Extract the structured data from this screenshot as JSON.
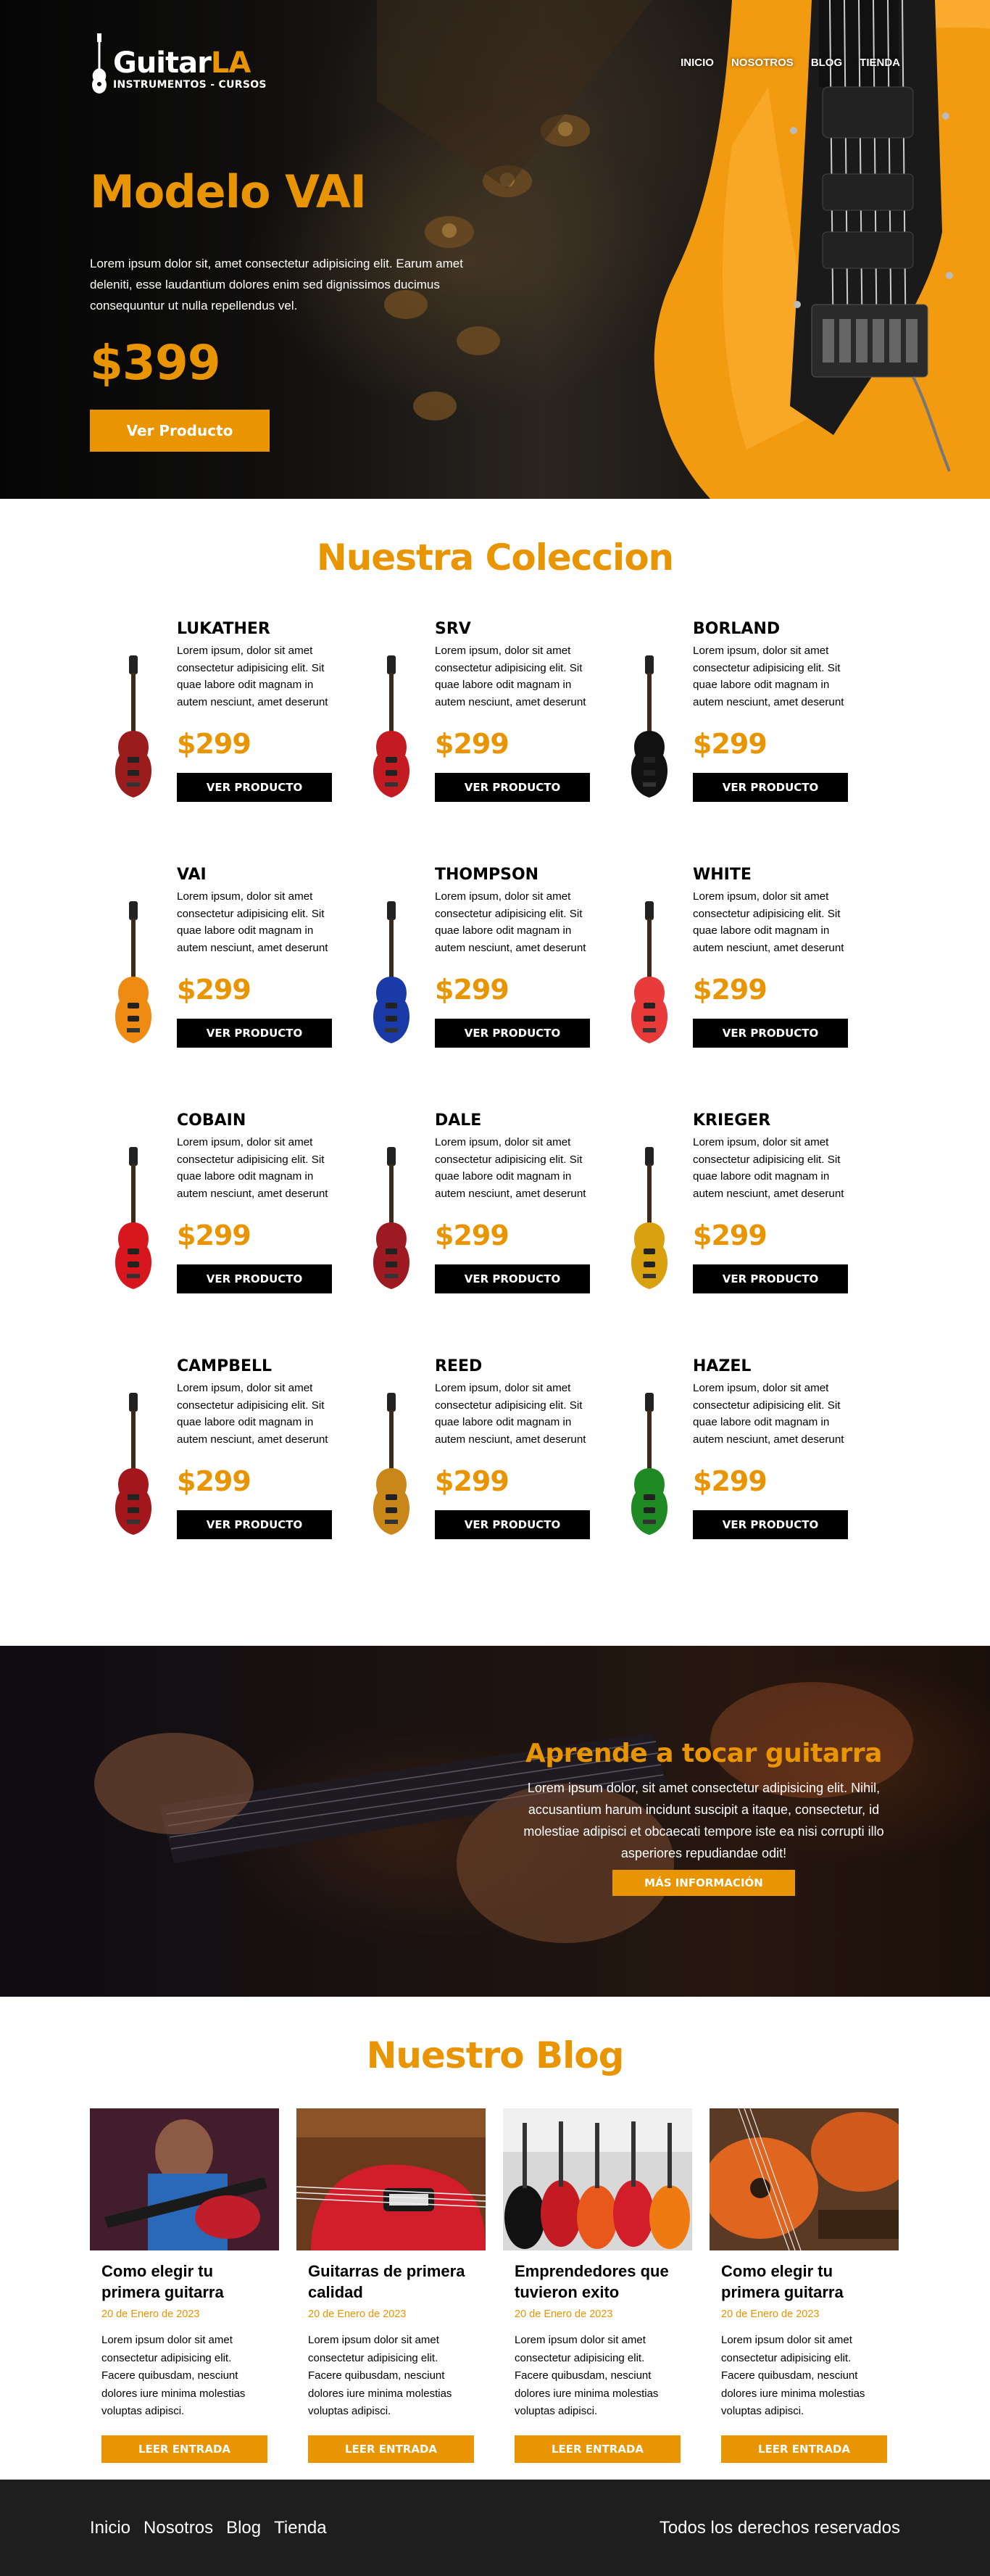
{
  "brand": {
    "name_main": "Guitar",
    "name_accent": "LA",
    "tagline": "INSTRUMENTOS - CURSOS"
  },
  "nav": [
    "Inicio",
    "Nosotros",
    "Blog",
    "Tienda"
  ],
  "hero": {
    "title": "Modelo VAI",
    "description": "Lorem ipsum dolor sit, amet consectetur adipisicing elit. Earum amet deleniti, esse laudantium dolores enim sed dignissimos ducimus consequuntur ut nulla repellendus vel.",
    "price": "$399",
    "button": "Ver Producto"
  },
  "collection": {
    "title": "Nuestra Coleccion",
    "products": [
      {
        "name": "LUKATHER",
        "price": "$299",
        "body": "#9b1c1c",
        "button": "VER PRODUCTO",
        "description": "Lorem ipsum, dolor sit amet consectetur adipisicing elit. Sit quae labore odit magnam in autem nesciunt, amet deserunt"
      },
      {
        "name": "SRV",
        "price": "$299",
        "body": "#c41a22",
        "button": "VER PRODUCTO",
        "description": "Lorem ipsum, dolor sit amet consectetur adipisicing elit. Sit quae labore odit magnam in autem nesciunt, amet deserunt"
      },
      {
        "name": "BORLAND",
        "price": "$299",
        "body": "#111111",
        "button": "VER PRODUCTO",
        "description": "Lorem ipsum, dolor sit amet consectetur adipisicing elit. Sit quae labore odit magnam in autem nesciunt, amet deserunt"
      },
      {
        "name": "VAI",
        "price": "$299",
        "body": "#ef8a12",
        "button": "VER PRODUCTO",
        "description": "Lorem ipsum, dolor sit amet consectetur adipisicing elit. Sit quae labore odit magnam in autem nesciunt, amet deserunt"
      },
      {
        "name": "THOMPSON",
        "price": "$299",
        "body": "#1a3aa8",
        "button": "VER PRODUCTO",
        "description": "Lorem ipsum, dolor sit amet consectetur adipisicing elit. Sit quae labore odit magnam in autem nesciunt, amet deserunt"
      },
      {
        "name": "WHITE",
        "price": "$299",
        "body": "#e83a3a",
        "button": "VER PRODUCTO",
        "description": "Lorem ipsum, dolor sit amet consectetur adipisicing elit. Sit quae labore odit magnam in autem nesciunt, amet deserunt"
      },
      {
        "name": "COBAIN",
        "price": "$299",
        "body": "#d8161e",
        "button": "VER PRODUCTO",
        "description": "Lorem ipsum, dolor sit amet consectetur adipisicing elit. Sit quae labore odit magnam in autem nesciunt, amet deserunt"
      },
      {
        "name": "DALE",
        "price": "$299",
        "body": "#9e1a22",
        "button": "VER PRODUCTO",
        "description": "Lorem ipsum, dolor sit amet consectetur adipisicing elit. Sit quae labore odit magnam in autem nesciunt, amet deserunt"
      },
      {
        "name": "KRIEGER",
        "price": "$299",
        "body": "#d9a010",
        "button": "VER PRODUCTO",
        "description": "Lorem ipsum, dolor sit amet consectetur adipisicing elit. Sit quae labore odit magnam in autem nesciunt, amet deserunt"
      },
      {
        "name": "CAMPBELL",
        "price": "$299",
        "body": "#a3171c",
        "button": "VER PRODUCTO",
        "description": "Lorem ipsum, dolor sit amet consectetur adipisicing elit. Sit quae labore odit magnam in autem nesciunt, amet deserunt"
      },
      {
        "name": "REED",
        "price": "$299",
        "body": "#c9871a",
        "button": "VER PRODUCTO",
        "description": "Lorem ipsum, dolor sit amet consectetur adipisicing elit. Sit quae labore odit magnam in autem nesciunt, amet deserunt"
      },
      {
        "name": "HAZEL",
        "price": "$299",
        "body": "#1f8a24",
        "button": "VER PRODUCTO",
        "description": "Lorem ipsum, dolor sit amet consectetur adipisicing elit. Sit quae labore odit magnam in autem nesciunt, amet deserunt"
      }
    ]
  },
  "classes": {
    "title": "Aprende a tocar guitarra",
    "description": "Lorem ipsum dolor, sit amet consectetur adipisicing elit. Nihil, accusantium harum incidunt suscipit a itaque, consectetur, id molestiae adipisci et obcaecati tempore iste ea nisi corrupti illo asperiores repudiandae odit!",
    "button": "MÁS INFORMACIÓN"
  },
  "blog": {
    "title": "Nuestro Blog",
    "posts": [
      {
        "title": "Como elegir tu primera guitarra",
        "date": "20 de Enero de 2023",
        "excerpt": "Lorem ipsum dolor sit amet consectetur adipisicing elit. Facere quibusdam, nesciunt dolores iure minima molestias voluptas adipisci.",
        "button": "LEER ENTRADA"
      },
      {
        "title": "Guitarras de primera calidad",
        "date": "20 de Enero de 2023",
        "excerpt": "Lorem ipsum dolor sit amet consectetur adipisicing elit. Facere quibusdam, nesciunt dolores iure minima molestias voluptas adipisci.",
        "button": "LEER ENTRADA"
      },
      {
        "title": "Emprendedores que tuvieron exito",
        "date": "20 de Enero de 2023",
        "excerpt": "Lorem ipsum dolor sit amet consectetur adipisicing elit. Facere quibusdam, nesciunt dolores iure minima molestias voluptas adipisci.",
        "button": "LEER ENTRADA"
      },
      {
        "title": "Como elegir tu primera guitarra",
        "date": "20 de Enero de 2023",
        "excerpt": "Lorem ipsum dolor sit amet consectetur adipisicing elit. Facere quibusdam, nesciunt dolores iure minima molestias voluptas adipisci.",
        "button": "LEER ENTRADA"
      }
    ]
  },
  "footer": {
    "nav": [
      "Inicio",
      "Nosotros",
      "Blog",
      "Tienda"
    ],
    "copyright": "Todos los derechos reservados"
  },
  "colors": {
    "accent": "#E99401",
    "dark": "#1e1e1e",
    "black": "#000000"
  }
}
